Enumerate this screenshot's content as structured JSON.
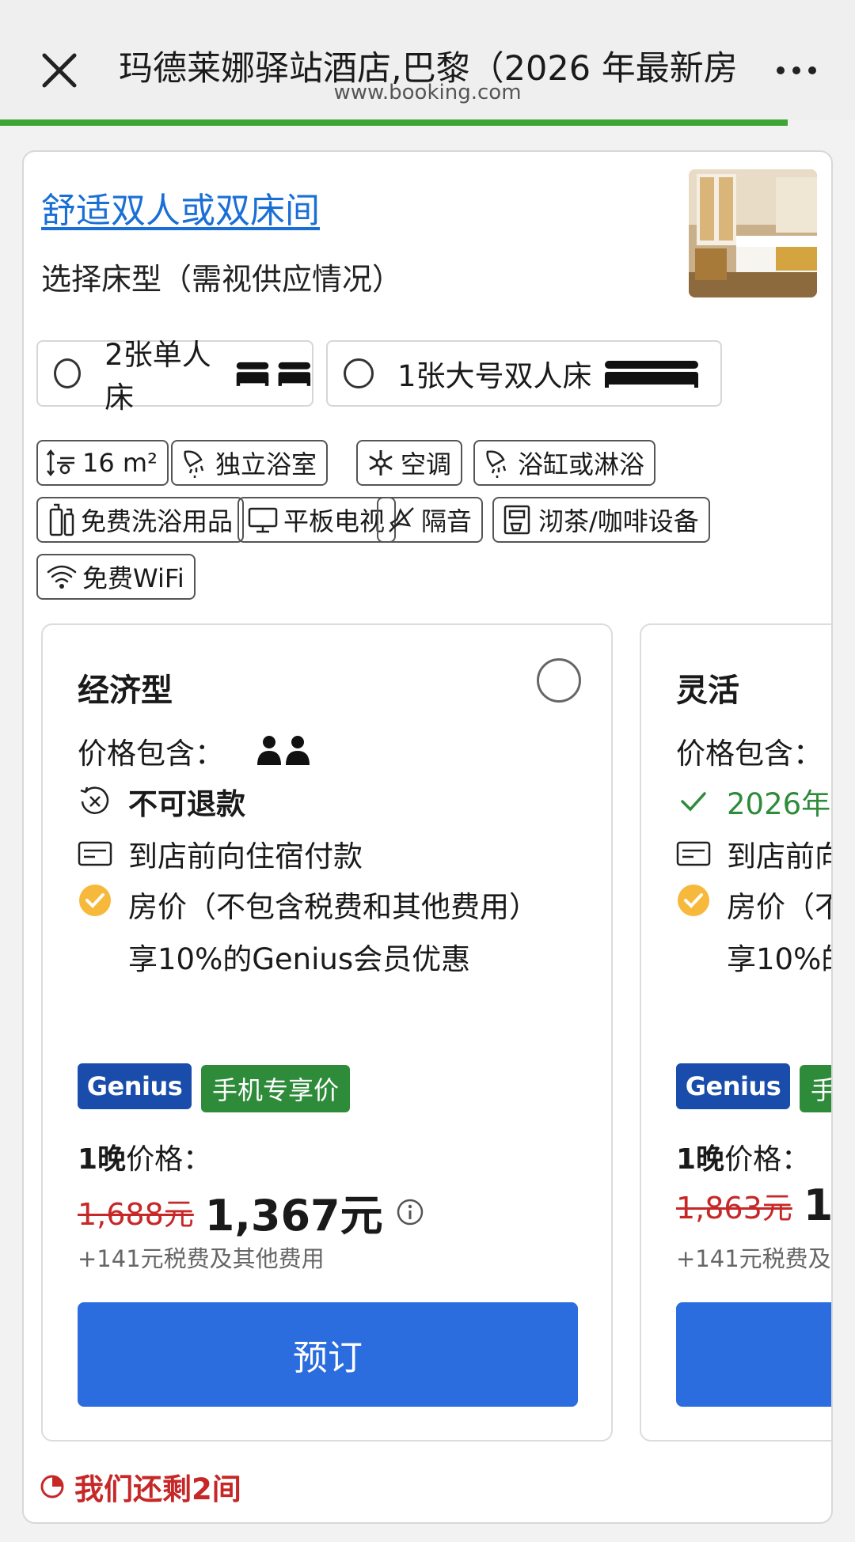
{
  "header": {
    "title": "玛德莱娜驿站酒店,巴黎（2026 年最新房",
    "url": "www.booking.com"
  },
  "room": {
    "title": "舒适双人或双床间",
    "bed_prompt": "选择床型（需视供应情况）",
    "bed_options": [
      {
        "label": "2张单人床"
      },
      {
        "label": "1张大号双人床"
      }
    ],
    "facilities": [
      {
        "label": "16 m²",
        "icon": "room-size-icon"
      },
      {
        "label": "独立浴室",
        "icon": "shower-icon"
      },
      {
        "label": "空调",
        "icon": "snowflake-icon"
      },
      {
        "label": "浴缸或淋浴",
        "icon": "shower-icon"
      },
      {
        "label": "免费洗浴用品",
        "icon": "toiletries-icon"
      },
      {
        "label": "平板电视",
        "icon": "tv-icon"
      },
      {
        "label": "隔音",
        "icon": "soundproof-icon"
      },
      {
        "label": "沏茶/咖啡设备",
        "icon": "coffee-machine-icon"
      },
      {
        "label": "免费WiFi",
        "icon": "wifi-icon"
      }
    ]
  },
  "plans": [
    {
      "name": "经济型",
      "includes_label": "价格包含：",
      "cancellation": "不可退款",
      "payment": "到店前向住宿付款",
      "rate_line1": "房价（不包含税费和其他费用）",
      "rate_line2": "享10%的Genius会员优惠",
      "genius_badge": "Genius",
      "mobile_badge": "手机专享价",
      "nights_bold": "1晚",
      "nights_label": "价格：",
      "old_price": "1,688元",
      "new_price": "1,367元",
      "taxes": "+141元税费及其他费用",
      "book_label": "预订"
    },
    {
      "name": "灵活",
      "includes_label": "价格包含：",
      "cancellation": "2026年",
      "payment": "到店前向",
      "rate_line1": "房价（不",
      "rate_line2": "享10%的",
      "genius_badge": "Genius",
      "mobile_badge": "手",
      "nights_bold": "1晚",
      "nights_label": "价格：",
      "old_price": "1,863元",
      "new_price": "1,",
      "taxes": "+141元税费及",
      "book_label": ""
    }
  ],
  "scarcity": "我们还剩2间",
  "colors": {
    "link": "#1a6fd6",
    "progress": "#3fa535",
    "genius": "#1a4dab",
    "mobile_badge": "#2e8b3a",
    "price_strike": "#c62828",
    "book_button": "#2b6cde",
    "check_green": "#2e8b3a"
  }
}
